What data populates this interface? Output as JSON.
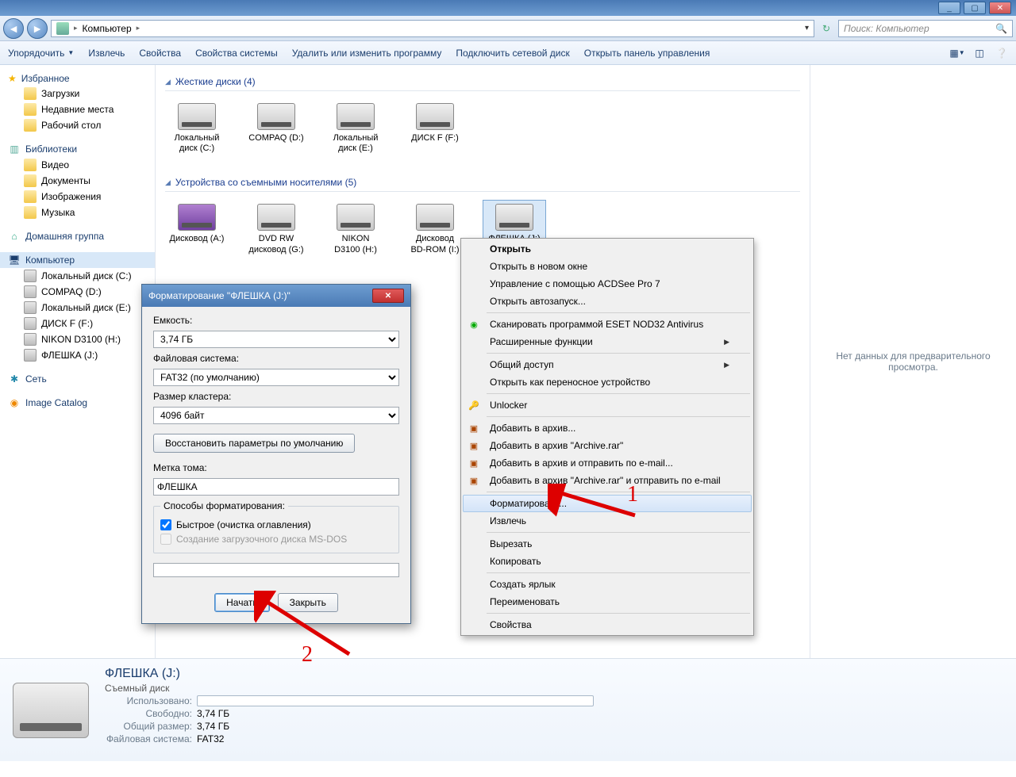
{
  "window": {
    "min": "_",
    "max": "▢",
    "close": "✕"
  },
  "breadcrumb": {
    "root": "Компьютер",
    "arrow": "▸",
    "refresh": "↻"
  },
  "search": {
    "placeholder": "Поиск: Компьютер"
  },
  "toolbar": {
    "organize": "Упорядочить",
    "eject": "Извлечь",
    "properties": "Свойства",
    "sysprops": "Свойства системы",
    "uninstall": "Удалить или изменить программу",
    "mapdrive": "Подключить сетевой диск",
    "cpanel": "Открыть панель управления"
  },
  "sidebar": {
    "favorites": "Избранное",
    "downloads": "Загрузки",
    "recent": "Недавние места",
    "desktop": "Рабочий стол",
    "libraries": "Библиотеки",
    "videos": "Видео",
    "documents": "Документы",
    "pictures": "Изображения",
    "music": "Музыка",
    "homegroup": "Домашняя группа",
    "computer": "Компьютер",
    "localc": "Локальный диск (C:)",
    "compaq": "COMPAQ (D:)",
    "locale": "Локальный диск (E:)",
    "diskf": "ДИСК F (F:)",
    "nikon": "NIKON D3100 (H:)",
    "flash": "ФЛЕШКА (J:)",
    "network": "Сеть",
    "imgcat": "Image Catalog"
  },
  "sections": {
    "hdd": "Жесткие диски (4)",
    "removable": "Устройства со съемными носителями (5)"
  },
  "drives_hdd": [
    {
      "label": "Локальный диск (C:)"
    },
    {
      "label": "COMPAQ (D:)"
    },
    {
      "label": "Локальный диск (E:)"
    },
    {
      "label": "ДИСК F (F:)"
    }
  ],
  "drives_rem": [
    {
      "label": "Дисковод (A:)"
    },
    {
      "label": "DVD RW дисковод (G:)"
    },
    {
      "label": "NIKON D3100 (H:)"
    },
    {
      "label": "Дисковод BD-ROM (I:)"
    },
    {
      "label": "ФЛЕШКА (J:)"
    }
  ],
  "preview": {
    "empty": "Нет данных для предварительного просмотра."
  },
  "details": {
    "title": "ФЛЕШКА (J:)",
    "type": "Съемный диск",
    "used_k": "Использовано:",
    "free_k": "Свободно:",
    "free_v": "3,74 ГБ",
    "total_k": "Общий размер:",
    "total_v": "3,74 ГБ",
    "fs_k": "Файловая система:",
    "fs_v": "FAT32"
  },
  "context": {
    "open": "Открыть",
    "opennew": "Открыть в новом окне",
    "acdsee": "Управление с помощью ACDSee Pro 7",
    "autorun": "Открыть автозапуск...",
    "eset": "Сканировать программой ESET NOD32 Antivirus",
    "advanced": "Расширенные функции",
    "share": "Общий доступ",
    "portable": "Открыть как переносное устройство",
    "unlocker": "Unlocker",
    "rar1": "Добавить в архив...",
    "rar2": "Добавить в архив \"Archive.rar\"",
    "rar3": "Добавить в архив и отправить по e-mail...",
    "rar4": "Добавить в архив \"Archive.rar\" и отправить по e-mail",
    "format": "Форматировать...",
    "eject": "Извлечь",
    "cut": "Вырезать",
    "copy": "Копировать",
    "shortcut": "Создать ярлык",
    "rename": "Переименовать",
    "props": "Свойства"
  },
  "dialog": {
    "title": "Форматирование \"ФЛЕШКА (J:)\"",
    "capacity_l": "Емкость:",
    "capacity_v": "3,74 ГБ",
    "fs_l": "Файловая система:",
    "fs_v": "FAT32 (по умолчанию)",
    "cluster_l": "Размер кластера:",
    "cluster_v": "4096 байт",
    "restore": "Восстановить параметры по умолчанию",
    "label_l": "Метка тома:",
    "label_v": "ФЛЕШКА",
    "methods": "Способы форматирования:",
    "quick": "Быстрое (очистка оглавления)",
    "msdos": "Создание загрузочного диска MS-DOS",
    "start": "Начать",
    "close": "Закрыть"
  },
  "ann": {
    "one": "1",
    "two": "2"
  }
}
